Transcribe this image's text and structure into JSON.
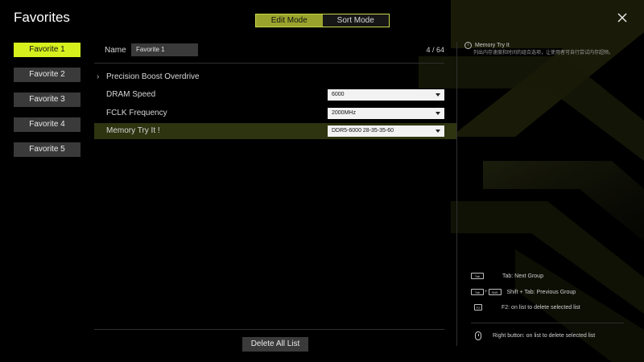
{
  "header": {
    "title": "Favorites",
    "close_icon": "close-icon"
  },
  "modes": [
    {
      "label": "Edit Mode",
      "active": true
    },
    {
      "label": "Sort Mode",
      "active": false
    }
  ],
  "favorites": [
    {
      "label": "Favorite 1",
      "active": true
    },
    {
      "label": "Favorite 2",
      "active": false
    },
    {
      "label": "Favorite 3",
      "active": false
    },
    {
      "label": "Favorite 4",
      "active": false
    },
    {
      "label": "Favorite 5",
      "active": false
    }
  ],
  "editor": {
    "name_label": "Name",
    "name_value": "Favorite 1",
    "counter": "4 / 64",
    "group": {
      "label": "Precision Boost Overdrive",
      "icon": "chevron-right-icon"
    },
    "settings": [
      {
        "label": "DRAM Speed",
        "value": "6000"
      },
      {
        "label": "FCLK Frequency",
        "value": "2000MHz"
      },
      {
        "label": "Memory Try It !",
        "value": "DDR5-6000 28-35-35-60"
      }
    ],
    "delete_all": "Delete All List"
  },
  "help": {
    "title": "Memory Try It",
    "description": "列出内存速度和时间的组合选项，让使用者可自行尝试内存超频。"
  },
  "hints": [
    {
      "keys": [
        "Tab"
      ],
      "text": "Tab: Next Group",
      "icon": "tab-key-icon"
    },
    {
      "keys": [
        "Tab",
        "Shift"
      ],
      "text": "Shift + Tab: Previous Group",
      "icon": "shift-tab-key-icon"
    },
    {
      "keys": [
        "F2"
      ],
      "text": "F2: on list to delete selected list",
      "icon": "f2-key-icon"
    },
    {
      "text": "Right button: on list to delete selected list",
      "icon": "mouse-icon"
    }
  ],
  "colors": {
    "accent": "#d6f01e",
    "mode_active": "#9aa42c",
    "selected_row": "#2e3310"
  }
}
